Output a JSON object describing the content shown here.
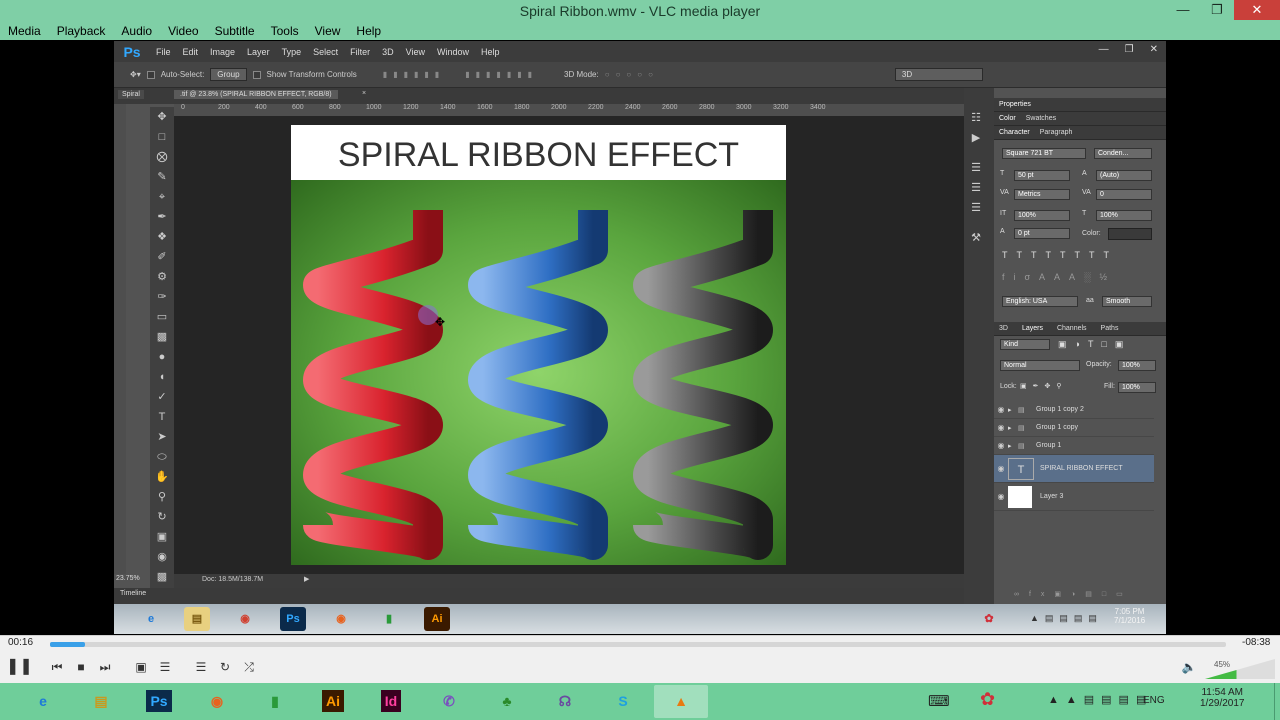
{
  "vlc": {
    "title": "Spiral Ribbon.wmv - VLC media player",
    "menu": [
      "Media",
      "Playback",
      "Audio",
      "Video",
      "Subtitle",
      "Tools",
      "View",
      "Help"
    ],
    "time_elapsed": "00:16",
    "time_remaining": "-08:38",
    "seek_progress": 0.03,
    "volume": "45%",
    "volume_level": 0.45
  },
  "photoshop": {
    "logo": "Ps",
    "menu": [
      "File",
      "Edit",
      "Image",
      "Layer",
      "Type",
      "Select",
      "Filter",
      "3D",
      "View",
      "Window",
      "Help"
    ],
    "options": {
      "auto_select_label": "Auto-Select:",
      "auto_select_value": "Group",
      "transform_label": "Show Transform Controls",
      "mode_label": "3D Mode:",
      "workspace": "3D"
    },
    "tab_1": "Spiral",
    "tab_2": ".tif @ 23.8% (SPIRAL RIBBON EFFECT, RGB/8)",
    "ruler_ticks": [
      "0",
      "200",
      "400",
      "600",
      "800",
      "1000",
      "1200",
      "1400",
      "1600",
      "1800",
      "2000",
      "2200",
      "2400",
      "2600",
      "2800",
      "3000",
      "3200",
      "3400"
    ],
    "doc_title": "SPIRAL RIBBON EFFECT",
    "zoom": "23.75%",
    "doc_info": "Doc: 18.5M/138.7M",
    "timeline": "Timeline",
    "panels": {
      "properties_tab": "Properties",
      "color_tab": "Color",
      "swatches_tab": "Swatches",
      "character_tab": "Character",
      "paragraph_tab": "Paragraph",
      "font_family": "Square 721 BT",
      "font_style": "Conden...",
      "font_size": "50 pt",
      "leading": "(Auto)",
      "kerning": "Metrics",
      "tracking": "0",
      "vscale": "100%",
      "hscale": "100%",
      "baseline": "0 pt",
      "color_label": "Color:",
      "language": "English: USA",
      "antialias": "Smooth",
      "layers_tabs": [
        "3D",
        "Layers",
        "Channels",
        "Paths"
      ],
      "kind": "Kind",
      "blend_mode": "Normal",
      "opacity_label": "Opacity:",
      "opacity": "100%",
      "lock_label": "Lock:",
      "fill_label": "Fill:",
      "fill": "100%"
    },
    "layers": [
      {
        "name": "Group 1 copy 2",
        "type": "group"
      },
      {
        "name": "Group 1 copy",
        "type": "group"
      },
      {
        "name": "Group 1",
        "type": "group"
      },
      {
        "name": "SPIRAL RIBBON EFFECT",
        "type": "text",
        "selected": true
      },
      {
        "name": "Layer 3",
        "type": "layer"
      }
    ],
    "ribbon_colors": [
      "#d9232e",
      "#2f6fc4",
      "#3c3c3c"
    ]
  },
  "inner_taskbar": {
    "clock_time": "7:05 PM",
    "clock_date": "7/1/2016"
  },
  "win_taskbar": {
    "clock_time": "11:54 AM",
    "clock_date": "1/29/2017",
    "lang": "ENG"
  }
}
